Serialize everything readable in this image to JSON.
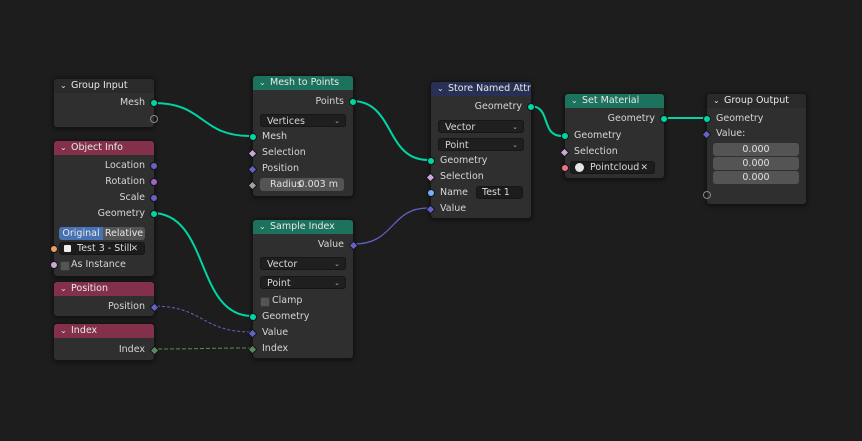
{
  "colors": {
    "geometry": "#00d6a3",
    "vector": "#6363c7",
    "int": "#598c5c",
    "string": "#70b2ff",
    "object": "#ed9e5c",
    "boolean": "#cca6d6",
    "material": "#eb7582",
    "float": "#a1a1a1"
  },
  "nodes": {
    "group_input": {
      "title": "Group Input",
      "out_geometry": "Mesh"
    },
    "object_info": {
      "title": "Object Info",
      "outputs": [
        "Location",
        "Rotation",
        "Scale",
        "Geometry"
      ],
      "mode_original": "Original",
      "mode_relative": "Relative",
      "object_value": "Test 3 - Still",
      "as_instance": "As Instance"
    },
    "position": {
      "title": "Position",
      "out": "Position"
    },
    "index": {
      "title": "Index",
      "out": "Index"
    },
    "mesh_to_points": {
      "title": "Mesh to Points",
      "out": "Points",
      "mode": "Vertices",
      "in_mesh": "Mesh",
      "in_selection": "Selection",
      "in_position": "Position",
      "radius_label": "Radius",
      "radius_value": "0.003 m"
    },
    "sample_index": {
      "title": "Sample Index",
      "out": "Value",
      "type": "Vector",
      "domain": "Point",
      "clamp": "Clamp",
      "in_geometry": "Geometry",
      "in_value": "Value",
      "in_index": "Index"
    },
    "store_named": {
      "title": "Store Named Attrib...",
      "out": "Geometry",
      "type": "Vector",
      "domain": "Point",
      "in_geometry": "Geometry",
      "in_selection": "Selection",
      "name_label": "Name",
      "name_value": "Test 1",
      "in_value": "Value"
    },
    "set_material": {
      "title": "Set Material",
      "out": "Geometry",
      "in_geometry": "Geometry",
      "in_selection": "Selection",
      "material": "Pointcloud"
    },
    "group_output": {
      "title": "Group Output",
      "in_geometry": "Geometry",
      "value_label": "Value:",
      "values": [
        "0.000",
        "0.000",
        "0.000"
      ]
    }
  }
}
